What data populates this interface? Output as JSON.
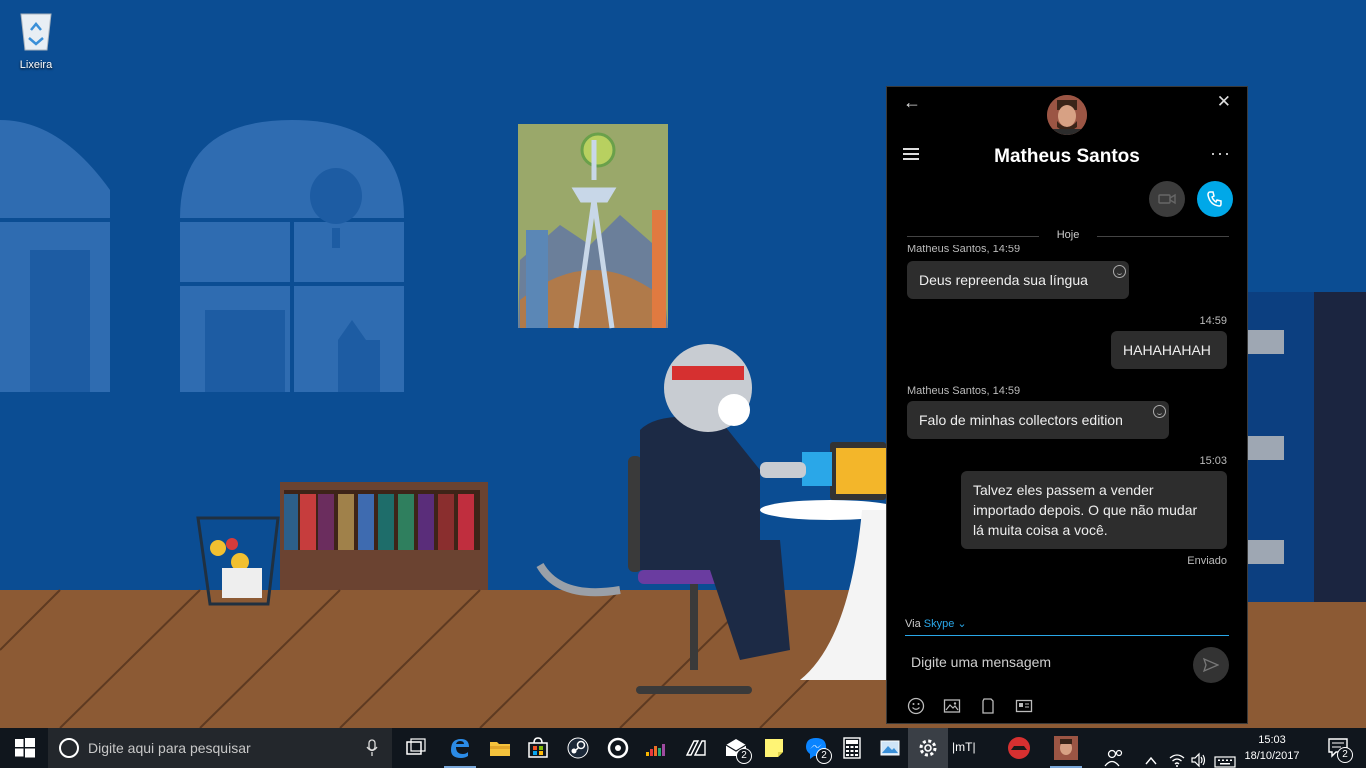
{
  "desktop": {
    "icons": [
      {
        "label": "Lixeira",
        "icon": "recycle-bin-icon"
      }
    ]
  },
  "chat": {
    "contact_name": "Matheus Santos",
    "day_label": "Hoje",
    "messages": [
      {
        "side": "in",
        "meta": "Matheus Santos, 14:59",
        "text": "Deus repreenda sua língua"
      },
      {
        "side": "out",
        "meta": "14:59",
        "text": "HAHAHAHAH"
      },
      {
        "side": "in",
        "meta": "Matheus Santos, 14:59",
        "text": "Falo de minhas collectors edition"
      },
      {
        "side": "out",
        "meta": "15:03",
        "text_lines": [
          "Talvez eles passem a vender",
          "importado depois. O que não mudar",
          "lá muita coisa a você."
        ],
        "status": "Enviado"
      }
    ],
    "via_prefix": "Via",
    "via_service": "Skype",
    "input_placeholder": "Digite uma mensagem",
    "accent": "#00a8e8"
  },
  "taskbar": {
    "search_placeholder": "Digite aqui para pesquisar",
    "apps": [
      {
        "name": "task-view-icon"
      },
      {
        "name": "edge-icon"
      },
      {
        "name": "file-explorer-icon"
      },
      {
        "name": "store-icon"
      },
      {
        "name": "steam-icon"
      },
      {
        "name": "groove-icon"
      },
      {
        "name": "deezer-icon"
      },
      {
        "name": "media-icon"
      },
      {
        "name": "mail-icon",
        "badge": "2"
      },
      {
        "name": "sticky-notes-icon"
      },
      {
        "name": "messenger-icon",
        "badge": "2"
      },
      {
        "name": "calculator-icon"
      },
      {
        "name": "photos-icon"
      },
      {
        "name": "settings-icon"
      },
      {
        "name": "mytube-icon",
        "label": "|mT|"
      },
      {
        "name": "car-app-icon"
      },
      {
        "name": "skype-avatar-icon"
      }
    ],
    "clock_time": "15:03",
    "clock_date": "18/10/2017",
    "notification_badge": "2"
  }
}
